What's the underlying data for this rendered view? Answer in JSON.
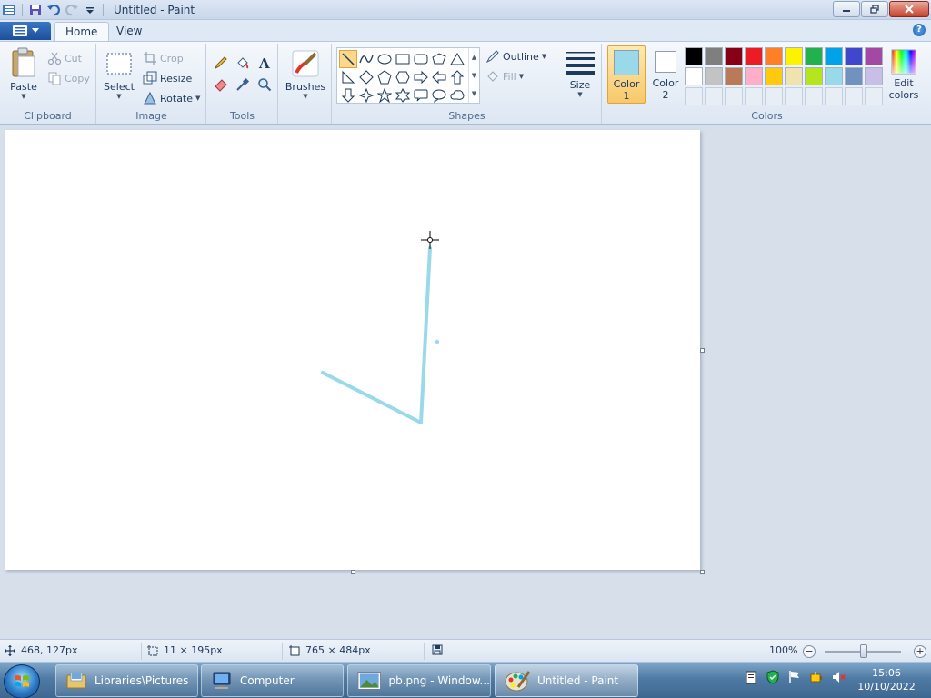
{
  "window": {
    "title": "Untitled - Paint"
  },
  "tabs": [
    {
      "label": "Home"
    },
    {
      "label": "View"
    }
  ],
  "clipboard": {
    "paste": "Paste",
    "cut": "Cut",
    "copy": "Copy",
    "group": "Clipboard"
  },
  "image": {
    "select": "Select",
    "crop": "Crop",
    "resize": "Resize",
    "rotate": "Rotate",
    "group": "Image"
  },
  "tools": {
    "group": "Tools"
  },
  "brushes": {
    "label": "Brushes"
  },
  "shapes": {
    "outline": "Outline",
    "fill": "Fill",
    "group": "Shapes"
  },
  "size": {
    "label": "Size"
  },
  "colors": {
    "color1_line1": "Color",
    "color1_line2": "1",
    "color2_line1": "Color",
    "color2_line2": "2",
    "edit_line1": "Edit",
    "edit_line2": "colors",
    "group": "Colors",
    "color1_value": "#99d9ea",
    "color2_value": "#ffffff",
    "palette": [
      "#000000",
      "#7f7f7f",
      "#880015",
      "#ed1c24",
      "#ff7f27",
      "#fff200",
      "#22b14c",
      "#00a2e8",
      "#3f48cc",
      "#a349a4",
      "#ffffff",
      "#c3c3c3",
      "#b97a57",
      "#ffaec9",
      "#ffc90e",
      "#efe4b0",
      "#b5e61d",
      "#99d9ea",
      "#7092be",
      "#c8bfe7"
    ]
  },
  "status": {
    "cursor_pos": "468, 127px",
    "selection_size": "11 × 195px",
    "canvas_size": "765 × 484px",
    "zoom": "100%"
  },
  "taskbar": {
    "items": [
      {
        "label": "Libraries\\Pictures"
      },
      {
        "label": "Computer"
      },
      {
        "label": "pb.png - Window..."
      },
      {
        "label": "Untitled - Paint"
      }
    ],
    "time": "15:06",
    "date": "10/10/2022"
  }
}
